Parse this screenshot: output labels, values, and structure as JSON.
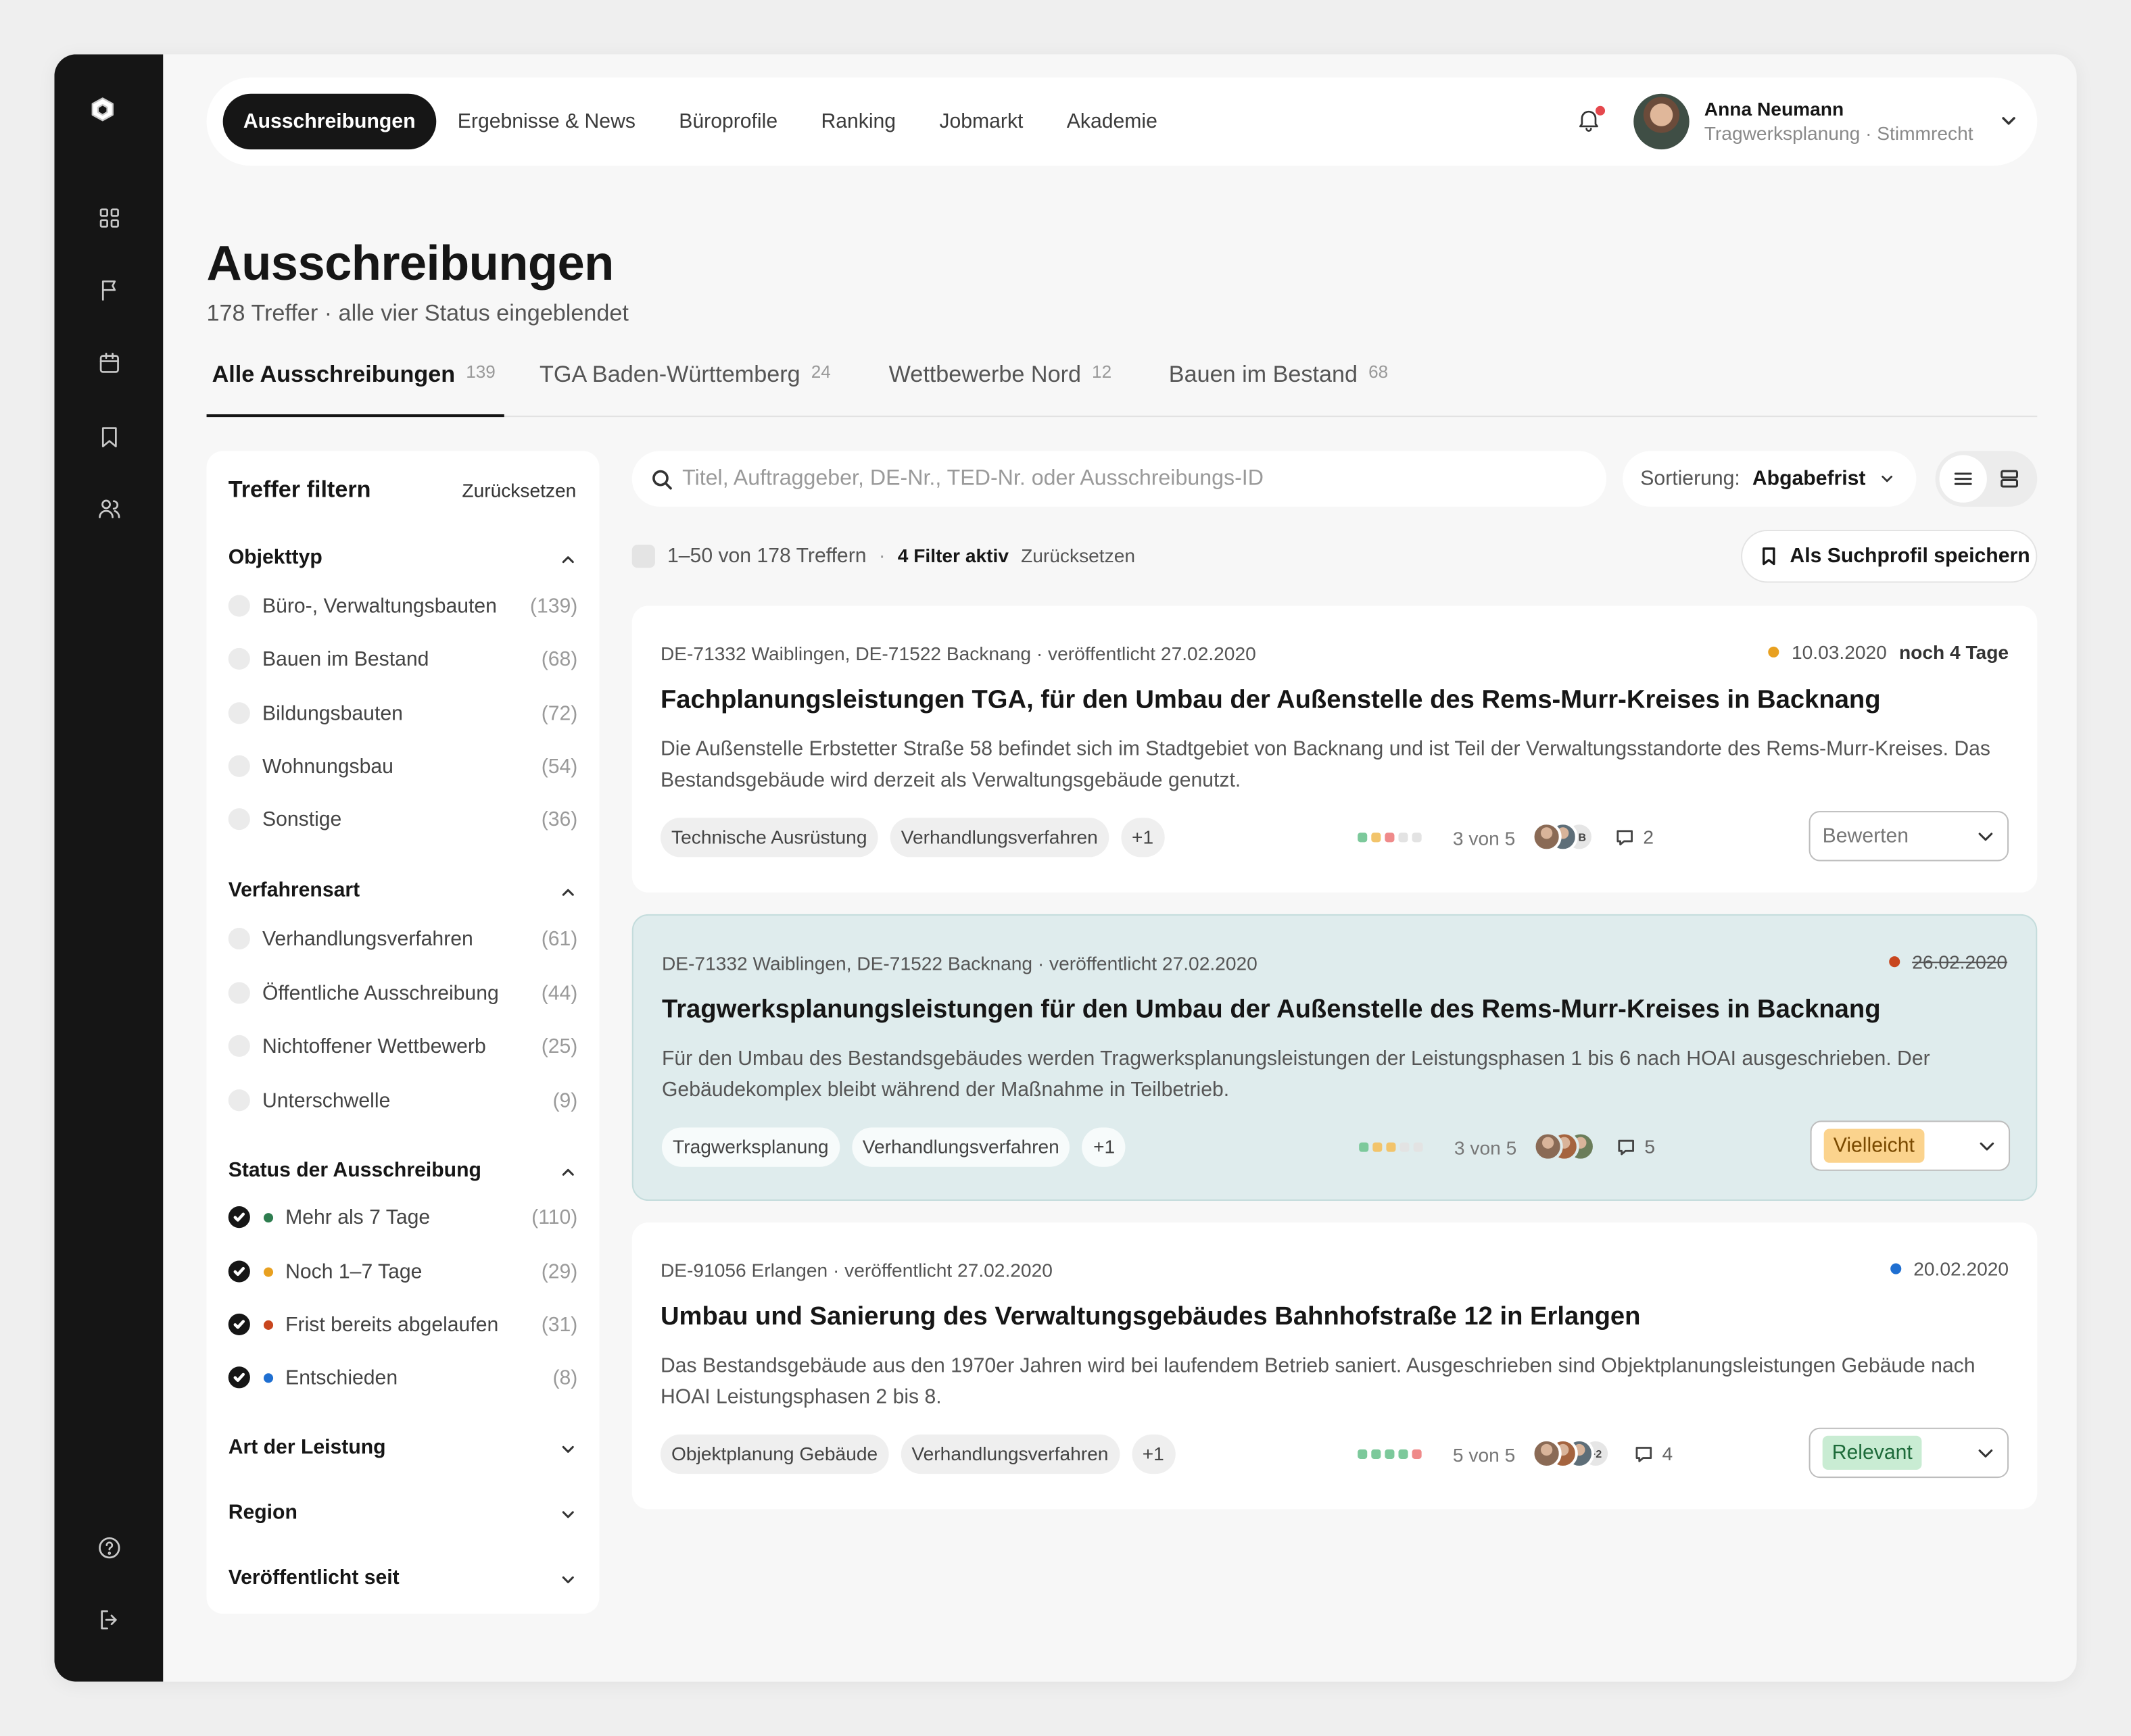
{
  "app": {
    "nav": [
      {
        "label": "Ausschreibungen",
        "active": true
      },
      {
        "label": "Ergebnisse & News"
      },
      {
        "label": "Büroprofile"
      },
      {
        "label": "Ranking"
      },
      {
        "label": "Jobmarkt"
      },
      {
        "label": "Akademie"
      }
    ],
    "user": {
      "name": "Anna Neumann",
      "role": "Tragwerksplanung · Stimmrecht"
    },
    "notification_dot_color": "#e5484d",
    "sidebar_icons": [
      "dashboard-icon",
      "flag-icon",
      "calendar-icon",
      "bookmark-icon",
      "users-icon",
      "help-icon",
      "logout-icon"
    ]
  },
  "page": {
    "title": "Ausschreibungen",
    "subtitle": "178 Treffer · alle vier Status eingeblendet",
    "tabs": [
      {
        "label": "Alle Ausschreibungen",
        "count": "139",
        "active": true
      },
      {
        "label": "TGA Baden-Württemberg",
        "count": "24"
      },
      {
        "label": "Wettbewerbe Nord",
        "count": "12"
      },
      {
        "label": "Bauen im Bestand",
        "count": "68"
      }
    ]
  },
  "filters": {
    "title": "Treffer filtern",
    "reset": "Zurücksetzen",
    "sections": [
      {
        "title": "Objekttyp",
        "expanded": true,
        "options": [
          {
            "label": "Büro-, Verwaltungsbauten",
            "count": "(139)"
          },
          {
            "label": "Bauen im Bestand",
            "count": "(68)"
          },
          {
            "label": "Bildungsbauten",
            "count": "(72)"
          },
          {
            "label": "Wohnungsbau",
            "count": "(54)"
          },
          {
            "label": "Sonstige",
            "count": "(36)"
          }
        ]
      },
      {
        "title": "Verfahrensart",
        "expanded": true,
        "options": [
          {
            "label": "Verhandlungsverfahren",
            "count": "(61)"
          },
          {
            "label": "Öffentliche Ausschreibung",
            "count": "(44)"
          },
          {
            "label": "Nichtoffener Wettbewerb",
            "count": "(25)"
          },
          {
            "label": "Unterschwelle",
            "count": "(9)"
          }
        ]
      },
      {
        "title": "Status der Ausschreibung",
        "expanded": true,
        "options": [
          {
            "label": "Mehr als 7 Tage",
            "count": "(110)",
            "checked": true,
            "color": "#2e7d4f"
          },
          {
            "label": "Noch 1–7 Tage",
            "count": "(29)",
            "checked": true,
            "color": "#e8a020"
          },
          {
            "label": "Frist bereits abgelaufen",
            "count": "(31)",
            "checked": true,
            "color": "#c8461e"
          },
          {
            "label": "Entschieden",
            "count": "(8)",
            "checked": true,
            "color": "#1f6fd1"
          }
        ]
      },
      {
        "title": "Art der Leistung",
        "expanded": false
      },
      {
        "title": "Region",
        "expanded": false
      },
      {
        "title": "Veröffentlicht seit",
        "expanded": false
      }
    ]
  },
  "toolbar": {
    "search_placeholder": "Titel, Auftraggeber, DE-Nr., TED-Nr. oder Ausschreibungs-ID",
    "sort_label": "Sortierung:",
    "sort_value": "Abgabefrist",
    "view_mode": "list",
    "result_range": "1–50 von 178 Treffern",
    "separator": "·",
    "filters_active": "4 Filter aktiv",
    "reset": "Zurücksetzen",
    "save_profile": "Als Suchprofil speichern"
  },
  "results": [
    {
      "meta": "DE-71332 Waiblingen, DE-71522 Backnang · veröffentlicht 27.02.2020",
      "deadline": "10.03.2020",
      "deadline_color": "#e8a020",
      "expired": false,
      "remaining": "noch 4 Tage",
      "title": "Fachplanungsleistungen TGA, für den Umbau der Außenstelle des Rems-Murr-Kreises in Backnang",
      "description": "Die Außenstelle Erbstetter Straße 58 befindet sich im Stadtgebiet von Backnang und ist Teil der Verwaltungsstandorte des Rems-Murr-Kreises. Das Bestandsgebäude wird derzeit als Verwaltungsgebäude genutzt.",
      "tags": [
        "Technische Ausrüstung",
        "Verhandlungsverfahren",
        "+1"
      ],
      "rating_bars": [
        "#7cc99b",
        "#f2c46b",
        "#ef8a8a",
        "#e3e3e3",
        "#e3e3e3"
      ],
      "rating_text": "3 von 5",
      "avatars": [
        "#8a6a55",
        "#5e6e78",
        "JB"
      ],
      "comments": "2",
      "decision": "Bewerten",
      "decision_bg": "",
      "decision_text_color": "#777",
      "selected": false
    },
    {
      "meta": "DE-71332 Waiblingen, DE-71522 Backnang · veröffentlicht 27.02.2020",
      "deadline": "26.02.2020",
      "deadline_color": "#c8461e",
      "expired": true,
      "remaining": "",
      "title": "Tragwerksplanungsleistungen für den Umbau der Außenstelle des Rems-Murr-Kreises in Backnang",
      "description": "Für den Umbau des Bestandsgebäudes werden Tragwerksplanungsleistungen der Leistungsphasen 1 bis 6 nach HOAI ausgeschrieben. Der Gebäudekomplex bleibt während der Maßnahme in Teilbetrieb.",
      "tags": [
        "Tragwerksplanung",
        "Verhandlungsverfahren",
        "+1"
      ],
      "rating_bars": [
        "#7cc99b",
        "#f2c46b",
        "#f2c46b",
        "#e3e3e3",
        "#e3e3e3"
      ],
      "rating_text": "3 von 5",
      "avatars": [
        "#8a6a55",
        "#a5643f",
        "#6b7d5a"
      ],
      "comments": "5",
      "decision": "Vielleicht",
      "decision_bg": "#fbd38d",
      "decision_text_color": "#7a4a00",
      "selected": true
    },
    {
      "meta": "DE-91056 Erlangen · veröffentlicht 27.02.2020",
      "deadline": "20.02.2020",
      "deadline_color": "#1f6fd1",
      "expired": false,
      "remaining": "",
      "title": "Umbau und Sanierung des Verwaltungsgebäudes Bahnhofstraße 12 in Erlangen",
      "description": "Das Bestandsgebäude aus den 1970er Jahren wird bei laufendem Betrieb saniert. Ausgeschrieben sind Objektplanungsleistungen Gebäude nach HOAI Leistungsphasen 2 bis 8.",
      "tags": [
        "Objektplanung Gebäude",
        "Verhandlungsverfahren",
        "+1"
      ],
      "rating_bars": [
        "#7cc99b",
        "#7cc99b",
        "#7cc99b",
        "#7cc99b",
        "#ef8a8a"
      ],
      "rating_text": "5 von 5",
      "avatars": [
        "#8a6a55",
        "#a5643f",
        "#5e6e78",
        "+2"
      ],
      "comments": "4",
      "decision": "Relevant",
      "decision_bg": "#c9ecd3",
      "decision_text_color": "#1e6b3a",
      "selected": false
    }
  ]
}
